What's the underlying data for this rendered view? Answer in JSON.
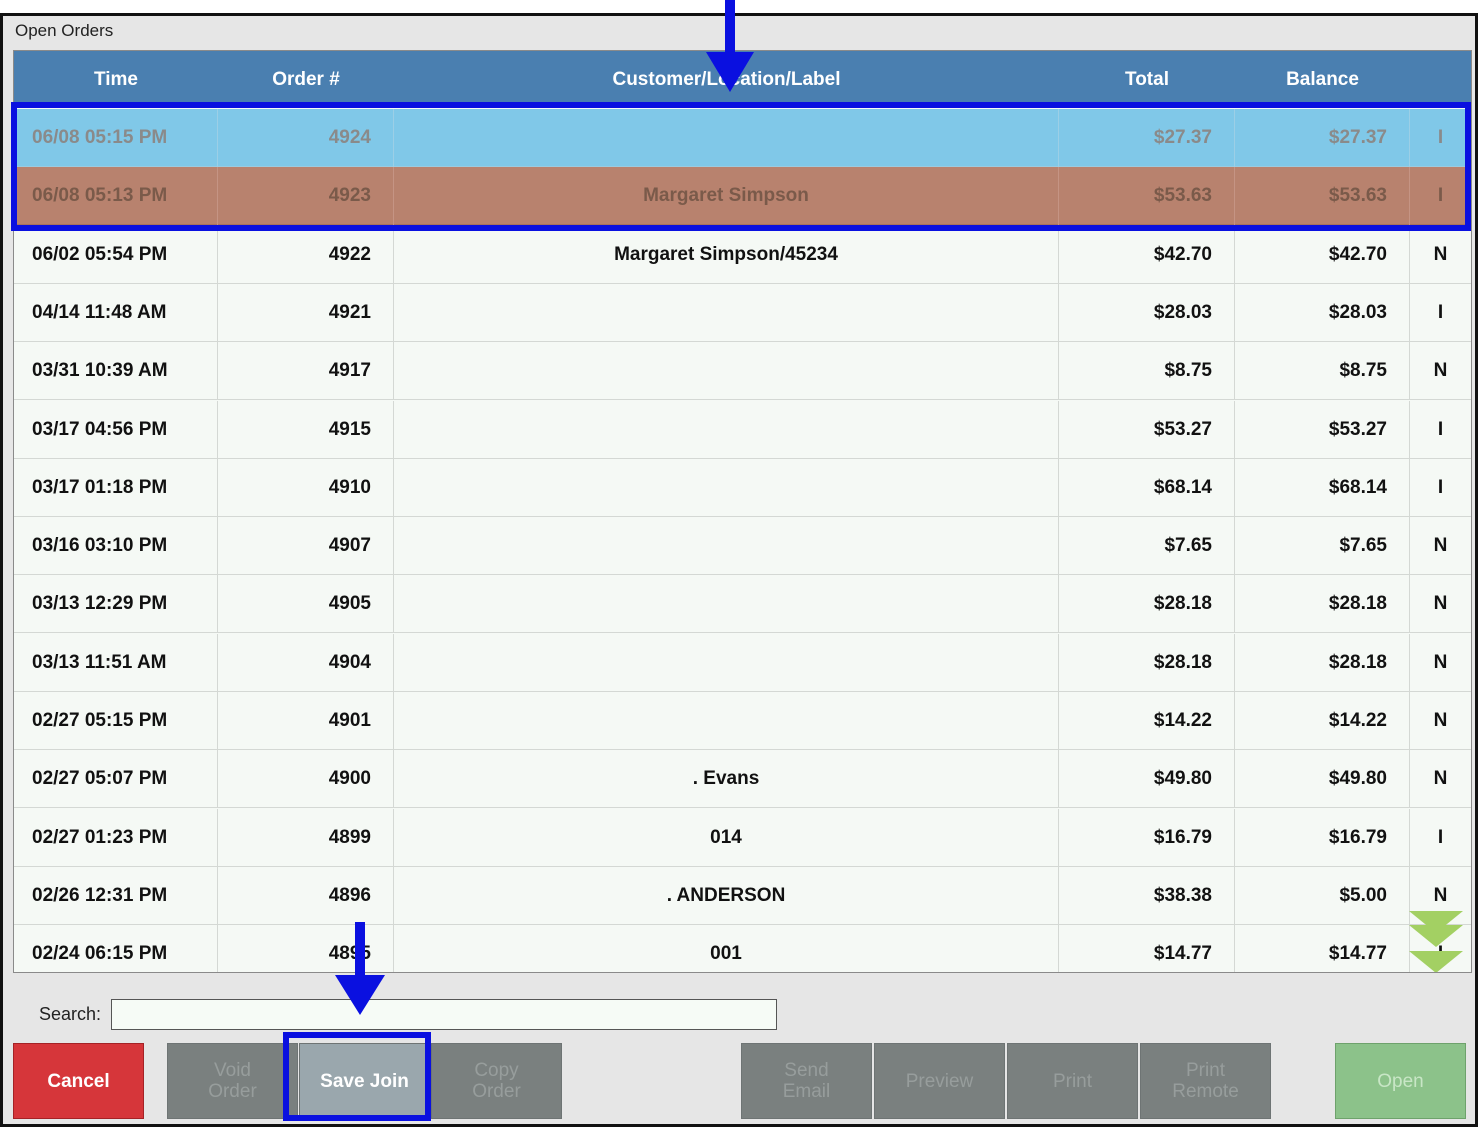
{
  "window": {
    "title": "Open Orders"
  },
  "columns": {
    "time": "Time",
    "order": "Order #",
    "customer": "Customer/Location/Label",
    "total": "Total",
    "balance": "Balance"
  },
  "rows": [
    {
      "time": "06/08 05:15 PM",
      "order": "4924",
      "customer": "",
      "total": "$27.37",
      "balance": "$27.37",
      "flag": "I",
      "state": "selected-primary",
      "color": "#80c8e8"
    },
    {
      "time": "06/08 05:13 PM",
      "order": "4923",
      "customer": "Margaret Simpson",
      "total": "$53.63",
      "balance": "$53.63",
      "flag": "I",
      "state": "selected-join",
      "color": "#b8826e"
    },
    {
      "time": "06/02 05:54 PM",
      "order": "4922",
      "customer": "Margaret Simpson/45234",
      "total": "$42.70",
      "balance": "$42.70",
      "flag": "N"
    },
    {
      "time": "04/14 11:48 AM",
      "order": "4921",
      "customer": "",
      "total": "$28.03",
      "balance": "$28.03",
      "flag": "I"
    },
    {
      "time": "03/31 10:39 AM",
      "order": "4917",
      "customer": "",
      "total": "$8.75",
      "balance": "$8.75",
      "flag": "N"
    },
    {
      "time": "03/17 04:56 PM",
      "order": "4915",
      "customer": "",
      "total": "$53.27",
      "balance": "$53.27",
      "flag": "I"
    },
    {
      "time": "03/17 01:18 PM",
      "order": "4910",
      "customer": "",
      "total": "$68.14",
      "balance": "$68.14",
      "flag": "I"
    },
    {
      "time": "03/16 03:10 PM",
      "order": "4907",
      "customer": "",
      "total": "$7.65",
      "balance": "$7.65",
      "flag": "N"
    },
    {
      "time": "03/13 12:29 PM",
      "order": "4905",
      "customer": "",
      "total": "$28.18",
      "balance": "$28.18",
      "flag": "N"
    },
    {
      "time": "03/13 11:51 AM",
      "order": "4904",
      "customer": "",
      "total": "$28.18",
      "balance": "$28.18",
      "flag": "N"
    },
    {
      "time": "02/27 05:15 PM",
      "order": "4901",
      "customer": "",
      "total": "$14.22",
      "balance": "$14.22",
      "flag": "N"
    },
    {
      "time": "02/27 05:07 PM",
      "order": "4900",
      "customer": ". Evans",
      "total": "$49.80",
      "balance": "$49.80",
      "flag": "N"
    },
    {
      "time": "02/27 01:23 PM",
      "order": "4899",
      "customer": "014",
      "total": "$16.79",
      "balance": "$16.79",
      "flag": "I"
    },
    {
      "time": "02/26 12:31 PM",
      "order": "4896",
      "customer": ". ANDERSON",
      "total": "$38.38",
      "balance": "$5.00",
      "flag": "N"
    },
    {
      "time": "02/24 06:15 PM",
      "order": "4895",
      "customer": "001",
      "total": "$14.77",
      "balance": "$14.77",
      "flag": "I"
    }
  ],
  "scroll": {
    "icon": "double-chevron-down-icon",
    "color": "#a3d063"
  },
  "search": {
    "label": "Search:",
    "value": "",
    "placeholder": ""
  },
  "buttons": {
    "cancel": "Cancel",
    "void_order": "Void\nOrder",
    "save_join": "Save Join",
    "copy_order": "Copy\nOrder",
    "send_email": "Send\nEmail",
    "preview": "Preview",
    "print": "Print",
    "print_remote": "Print\nRemote",
    "open": "Open"
  },
  "annotations": {
    "color": "#0a10e0"
  }
}
